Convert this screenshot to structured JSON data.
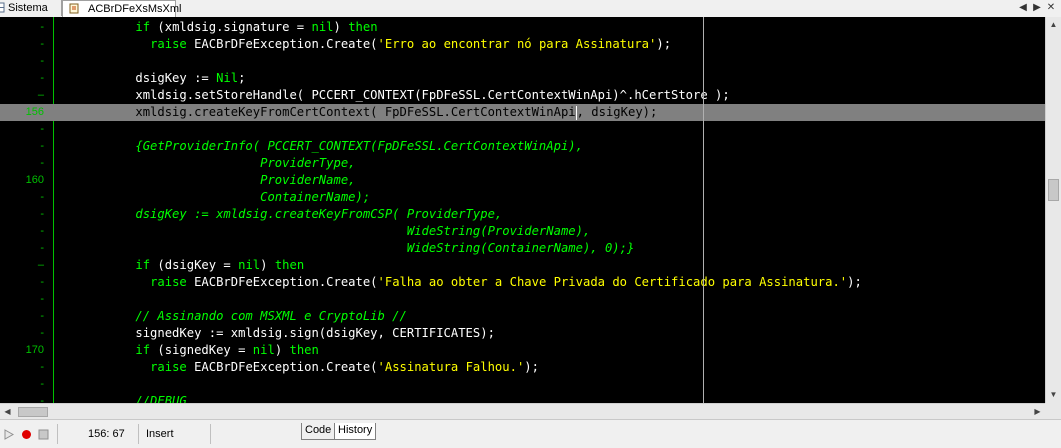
{
  "tabs": [
    {
      "label": "Sistema",
      "icon": "grid-icon"
    },
    {
      "label": "ACBrDFeXsMsXml",
      "icon": "unit-file-icon",
      "active": true
    }
  ],
  "window_buttons": {
    "back": "◀",
    "forward": "▶",
    "close": "✕"
  },
  "editor": {
    "gutter_labels": [
      "-",
      "-",
      "-",
      "-",
      "–",
      "156",
      "-",
      "-",
      "-",
      "160",
      "-",
      "-",
      "-",
      "-",
      "–",
      "-",
      "-",
      "-",
      "-",
      "170",
      "-",
      "-",
      "-"
    ],
    "current_line_index": 5,
    "lines": [
      [
        {
          "t": "kw",
          "v": "          if"
        },
        {
          "t": "txt",
          "v": " (xmldsig.signature = "
        },
        {
          "t": "kw",
          "v": "nil"
        },
        {
          "t": "txt",
          "v": ") "
        },
        {
          "t": "kw",
          "v": "then"
        }
      ],
      [
        {
          "t": "txt",
          "v": "            "
        },
        {
          "t": "kw",
          "v": "raise"
        },
        {
          "t": "txt",
          "v": " EACBrDFeException.Create("
        },
        {
          "t": "str",
          "v": "'Erro ao encontrar nó para Assinatura'"
        },
        {
          "t": "txt",
          "v": ");"
        }
      ],
      [],
      [
        {
          "t": "txt",
          "v": "          dsigKey := "
        },
        {
          "t": "kw",
          "v": "Nil"
        },
        {
          "t": "txt",
          "v": ";"
        }
      ],
      [
        {
          "t": "txt",
          "v": "          xmldsig.setStoreHandle( PCCERT_CONTEXT(FpDFeSSL.CertContextWinApi)^.hCertStore );"
        }
      ],
      [
        {
          "t": "txt",
          "v": "          xmldsig.createKeyFromCertContext( FpDFeSSL.CertContextWinApi"
        },
        {
          "t": "caret",
          "v": ""
        },
        {
          "t": "txt",
          "v": ", dsigKey);"
        }
      ],
      [],
      [
        {
          "t": "cmt",
          "v": "          {GetProviderInfo( PCCERT_CONTEXT(FpDFeSSL.CertContextWinApi),"
        }
      ],
      [
        {
          "t": "cmt",
          "v": "                           ProviderType,"
        }
      ],
      [
        {
          "t": "cmt",
          "v": "                           ProviderName,"
        }
      ],
      [
        {
          "t": "cmt",
          "v": "                           ContainerName);"
        }
      ],
      [
        {
          "t": "cmt",
          "v": "          dsigKey := xmldsig.createKeyFromCSP( ProviderType,"
        }
      ],
      [
        {
          "t": "cmt",
          "v": "                                               WideString(ProviderName),"
        }
      ],
      [
        {
          "t": "cmt",
          "v": "                                               WideString(ContainerName), 0);}"
        }
      ],
      [
        {
          "t": "kw",
          "v": "          if"
        },
        {
          "t": "txt",
          "v": " (dsigKey = "
        },
        {
          "t": "kw",
          "v": "nil"
        },
        {
          "t": "txt",
          "v": ") "
        },
        {
          "t": "kw",
          "v": "then"
        }
      ],
      [
        {
          "t": "txt",
          "v": "            "
        },
        {
          "t": "kw",
          "v": "raise"
        },
        {
          "t": "txt",
          "v": " EACBrDFeException.Create("
        },
        {
          "t": "str",
          "v": "'Falha ao obter a Chave Privada do Certificado para Assinatura.'"
        },
        {
          "t": "txt",
          "v": ");"
        }
      ],
      [],
      [
        {
          "t": "cmt",
          "v": "          // Assinando com MSXML e CryptoLib //"
        }
      ],
      [
        {
          "t": "txt",
          "v": "          signedKey := xmldsig.sign(dsigKey, CERTIFICATES);"
        }
      ],
      [
        {
          "t": "kw",
          "v": "          if"
        },
        {
          "t": "txt",
          "v": " (signedKey = "
        },
        {
          "t": "kw",
          "v": "nil"
        },
        {
          "t": "txt",
          "v": ") "
        },
        {
          "t": "kw",
          "v": "then"
        }
      ],
      [
        {
          "t": "txt",
          "v": "            "
        },
        {
          "t": "kw",
          "v": "raise"
        },
        {
          "t": "txt",
          "v": " EACBrDFeException.Create("
        },
        {
          "t": "str",
          "v": "'Assinatura Falhou.'"
        },
        {
          "t": "txt",
          "v": ");"
        }
      ],
      [],
      [
        {
          "t": "cmt",
          "v": "          //DEBUG"
        }
      ]
    ]
  },
  "status": {
    "cursor_position": "156: 67",
    "insert_mode": "Insert",
    "play_icon": "play-icon",
    "record_icon": "record-icon",
    "stop_icon": "stop-icon"
  },
  "bottom_tabs": {
    "code": "Code",
    "history": "History"
  },
  "colors": {
    "keyword": "#00ff00",
    "string": "#ffff00",
    "text": "#ffffff",
    "comment": "#00ff00",
    "gutter_number": "#00c000",
    "current_line": "#808080"
  }
}
